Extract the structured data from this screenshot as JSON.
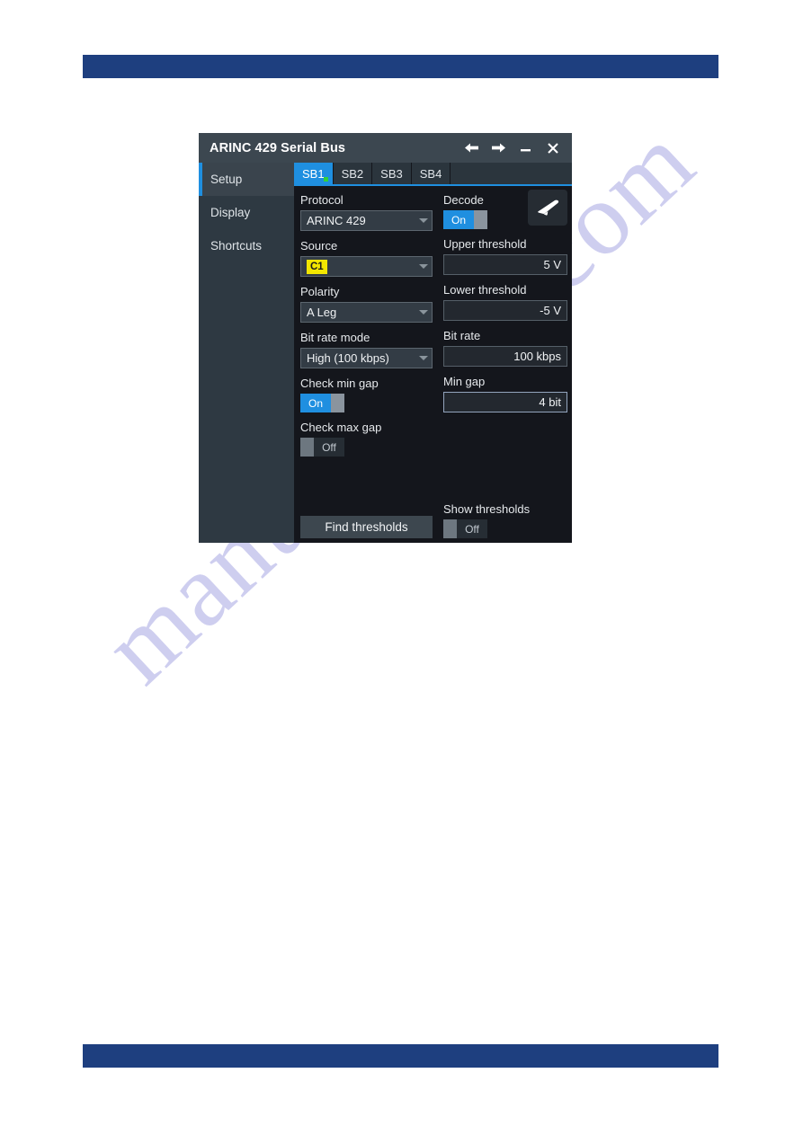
{
  "watermark": {
    "text": "manualshive.com"
  },
  "doc": {
    "header_bar_color": "#1e3f7f",
    "footer_bar_color": "#1e3f7f"
  },
  "dialog": {
    "title": "ARINC 429 Serial Bus",
    "window_buttons": [
      {
        "name": "back-icon",
        "label": "Back"
      },
      {
        "name": "forward-icon",
        "label": "Forward"
      },
      {
        "name": "minimize-icon",
        "label": "Minimize"
      },
      {
        "name": "close-icon",
        "label": "Close"
      }
    ],
    "sidebar": {
      "items": [
        {
          "label": "Setup",
          "active": true
        },
        {
          "label": "Display",
          "active": false
        },
        {
          "label": "Shortcuts",
          "active": false
        }
      ]
    },
    "tabs": [
      {
        "label": "SB1",
        "active": true,
        "indicator": "green"
      },
      {
        "label": "SB2",
        "active": false
      },
      {
        "label": "SB3",
        "active": false
      },
      {
        "label": "SB4",
        "active": false
      }
    ],
    "fields": {
      "protocol": {
        "label": "Protocol",
        "value": "ARINC 429"
      },
      "source": {
        "label": "Source",
        "badge": "C1",
        "value": ""
      },
      "polarity": {
        "label": "Polarity",
        "value": "A Leg"
      },
      "bit_rate_mode": {
        "label": "Bit rate mode",
        "value": "High (100 kbps)"
      },
      "check_min_gap": {
        "label": "Check min gap",
        "value": "On",
        "state": "on"
      },
      "check_max_gap": {
        "label": "Check max gap",
        "value": "Off",
        "state": "off"
      },
      "decode": {
        "label": "Decode",
        "value": "On",
        "state": "on"
      },
      "upper_threshold": {
        "label": "Upper threshold",
        "value": "5 V"
      },
      "lower_threshold": {
        "label": "Lower threshold",
        "value": "-5 V"
      },
      "bit_rate": {
        "label": "Bit rate",
        "value": "100 kbps"
      },
      "min_gap": {
        "label": "Min gap",
        "value": "4 bit"
      },
      "show_thresholds": {
        "label": "Show thresholds",
        "value": "Off",
        "state": "off"
      }
    },
    "buttons": {
      "find_thresholds": "Find thresholds"
    },
    "icons": {
      "protocol_badge": "airplane-icon"
    },
    "colors": {
      "accent_blue": "#1f8fe0",
      "channel_yellow": "#f2e600",
      "indicator_green": "#32d13a",
      "panel_bg": "#14161c",
      "sidebar_bg": "#2e3942",
      "titlebar_bg": "#3c4750"
    }
  }
}
